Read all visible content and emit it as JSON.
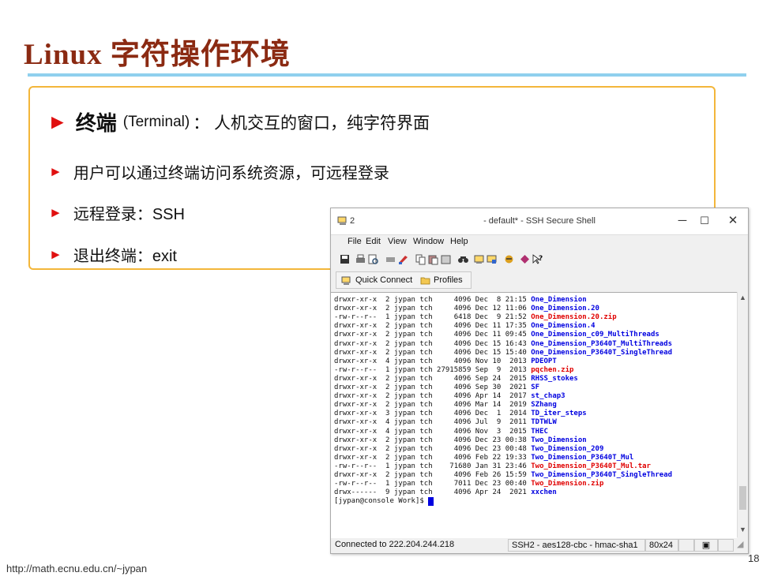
{
  "slide": {
    "title": "Linux 字符操作环境",
    "footer_url": "http://math.ecnu.edu.cn/~jypan",
    "page_number": "18",
    "bullet_glyph": "►",
    "accent_colors": {
      "title": "#8b2a12",
      "rule": "#8fd0ee",
      "box_border": "#f3b63a",
      "bullet": "#e01010"
    },
    "bullets": {
      "b1_strong": "终端",
      "b1_en": "(Terminal)",
      "b1_rest": "： 人机交互的窗口，纯字符界面",
      "b2": "用户可以通过终端访问系统资源，可远程登录",
      "b3": "远程登录：SSH",
      "b4": "退出终端：exit"
    }
  },
  "window": {
    "icon": "computer-icon",
    "number": "2",
    "title": "- default* - SSH Secure Shell",
    "controls": {
      "minimize": "─",
      "maximize": "☐",
      "close": "✕"
    },
    "menu": [
      "File",
      "Edit",
      "View",
      "Window",
      "Help"
    ],
    "toolbar_icons": [
      "save-icon",
      "print-icon",
      "print-preview-icon",
      "disconnect-icon",
      "settings-icon",
      "copy-icon",
      "paste-icon",
      "paste-alt-icon",
      "find-icon",
      "new-terminal-icon",
      "new-file-transfer-icon",
      "file-transfer-icon",
      "key-icon",
      "help-icon"
    ],
    "quick_connect": "Quick Connect",
    "profiles": "Profiles",
    "terminal": {
      "rows": [
        {
          "perm": "drwxr-xr-x",
          "links": "2",
          "user": "jypan",
          "group": "tch",
          "size": "4096",
          "mon": "Dec",
          "day": "8",
          "time": "21:15",
          "name": "One_Dimension",
          "color": "blue"
        },
        {
          "perm": "drwxr-xr-x",
          "links": "2",
          "user": "jypan",
          "group": "tch",
          "size": "4096",
          "mon": "Dec",
          "day": "12",
          "time": "11:06",
          "name": "One_Dimension.20",
          "color": "blue"
        },
        {
          "perm": "-rw-r--r--",
          "links": "1",
          "user": "jypan",
          "group": "tch",
          "size": "6418",
          "mon": "Dec",
          "day": "9",
          "time": "21:52",
          "name": "One_Dimension.20.zip",
          "color": "red"
        },
        {
          "perm": "drwxr-xr-x",
          "links": "2",
          "user": "jypan",
          "group": "tch",
          "size": "4096",
          "mon": "Dec",
          "day": "11",
          "time": "17:35",
          "name": "One_Dimension.4",
          "color": "blue"
        },
        {
          "perm": "drwxr-xr-x",
          "links": "2",
          "user": "jypan",
          "group": "tch",
          "size": "4096",
          "mon": "Dec",
          "day": "11",
          "time": "09:45",
          "name": "One_Dimension_c09_MultiThreads",
          "color": "blue"
        },
        {
          "perm": "drwxr-xr-x",
          "links": "2",
          "user": "jypan",
          "group": "tch",
          "size": "4096",
          "mon": "Dec",
          "day": "15",
          "time": "16:43",
          "name": "One_Dimension_P3640T_MultiThreads",
          "color": "blue"
        },
        {
          "perm": "drwxr-xr-x",
          "links": "2",
          "user": "jypan",
          "group": "tch",
          "size": "4096",
          "mon": "Dec",
          "day": "15",
          "time": "15:40",
          "name": "One_Dimension_P3640T_SingleThread",
          "color": "blue"
        },
        {
          "perm": "drwxr-xr-x",
          "links": "4",
          "user": "jypan",
          "group": "tch",
          "size": "4096",
          "mon": "Nov",
          "day": "10",
          "time": "2013",
          "name": "PDEOPT",
          "color": "blue"
        },
        {
          "perm": "-rw-r--r--",
          "links": "1",
          "user": "jypan",
          "group": "tch",
          "size": "27915859",
          "mon": "Sep",
          "day": "9",
          "time": "2013",
          "name": "pqchen.zip",
          "color": "red"
        },
        {
          "perm": "drwxr-xr-x",
          "links": "2",
          "user": "jypan",
          "group": "tch",
          "size": "4096",
          "mon": "Sep",
          "day": "24",
          "time": "2015",
          "name": "RHSS_stokes",
          "color": "blue"
        },
        {
          "perm": "drwxr-xr-x",
          "links": "2",
          "user": "jypan",
          "group": "tch",
          "size": "4096",
          "mon": "Sep",
          "day": "30",
          "time": "2021",
          "name": "SF",
          "color": "blue"
        },
        {
          "perm": "drwxr-xr-x",
          "links": "2",
          "user": "jypan",
          "group": "tch",
          "size": "4096",
          "mon": "Apr",
          "day": "14",
          "time": "2017",
          "name": "st_chap3",
          "color": "blue"
        },
        {
          "perm": "drwxr-xr-x",
          "links": "2",
          "user": "jypan",
          "group": "tch",
          "size": "4096",
          "mon": "Mar",
          "day": "14",
          "time": "2019",
          "name": "SZhang",
          "color": "blue"
        },
        {
          "perm": "drwxr-xr-x",
          "links": "3",
          "user": "jypan",
          "group": "tch",
          "size": "4096",
          "mon": "Dec",
          "day": "1",
          "time": "2014",
          "name": "TD_iter_steps",
          "color": "blue"
        },
        {
          "perm": "drwxr-xr-x",
          "links": "4",
          "user": "jypan",
          "group": "tch",
          "size": "4096",
          "mon": "Jul",
          "day": "9",
          "time": "2011",
          "name": "TDTWLW",
          "color": "blue"
        },
        {
          "perm": "drwxr-xr-x",
          "links": "4",
          "user": "jypan",
          "group": "tch",
          "size": "4096",
          "mon": "Nov",
          "day": "3",
          "time": "2015",
          "name": "THEC",
          "color": "blue"
        },
        {
          "perm": "drwxr-xr-x",
          "links": "2",
          "user": "jypan",
          "group": "tch",
          "size": "4096",
          "mon": "Dec",
          "day": "23",
          "time": "00:38",
          "name": "Two_Dimension",
          "color": "blue"
        },
        {
          "perm": "drwxr-xr-x",
          "links": "2",
          "user": "jypan",
          "group": "tch",
          "size": "4096",
          "mon": "Dec",
          "day": "23",
          "time": "00:48",
          "name": "Two_Dimension_209",
          "color": "blue"
        },
        {
          "perm": "drwxr-xr-x",
          "links": "2",
          "user": "jypan",
          "group": "tch",
          "size": "4096",
          "mon": "Feb",
          "day": "22",
          "time": "19:33",
          "name": "Two_Dimension_P3640T_Mul",
          "color": "blue"
        },
        {
          "perm": "-rw-r--r--",
          "links": "1",
          "user": "jypan",
          "group": "tch",
          "size": "71680",
          "mon": "Jan",
          "day": "31",
          "time": "23:46",
          "name": "Two_Dimension_P3640T_Mul.tar",
          "color": "red"
        },
        {
          "perm": "drwxr-xr-x",
          "links": "2",
          "user": "jypan",
          "group": "tch",
          "size": "4096",
          "mon": "Feb",
          "day": "26",
          "time": "15:59",
          "name": "Two_Dimension_P3640T_SingleThread",
          "color": "blue"
        },
        {
          "perm": "-rw-r--r--",
          "links": "1",
          "user": "jypan",
          "group": "tch",
          "size": "7011",
          "mon": "Dec",
          "day": "23",
          "time": "00:40",
          "name": "Two_Dimension.zip",
          "color": "red"
        },
        {
          "perm": "drwx------",
          "links": "9",
          "user": "jypan",
          "group": "tch",
          "size": "4096",
          "mon": "Apr",
          "day": "24",
          "time": "2021",
          "name": "xxchen",
          "color": "blue"
        }
      ],
      "prompt": "[jypan@console Work]$ ",
      "colors": {
        "blue": "#0000e0",
        "red": "#e00000"
      }
    },
    "status": {
      "connection": "Connected to 222.204.244.218",
      "cipher": "SSH2 - aes128-cbc - hmac-sha1",
      "size": "80x24"
    }
  }
}
